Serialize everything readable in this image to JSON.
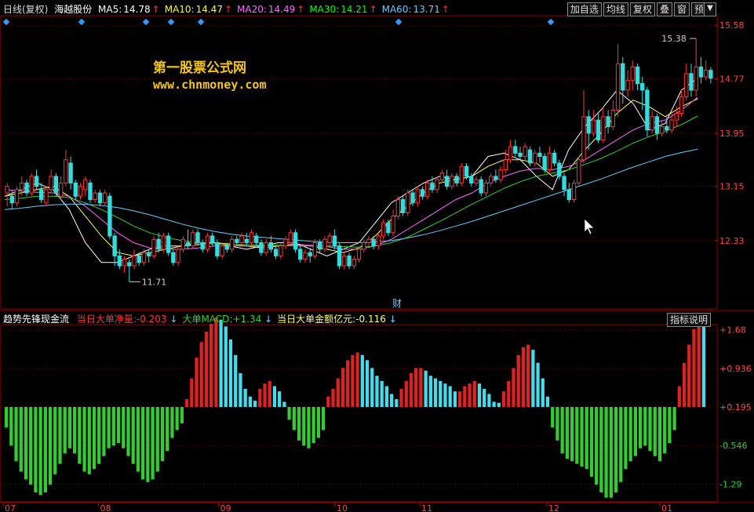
{
  "header": {
    "period": "日线(复权)",
    "stock_name": "海越股份",
    "ma": [
      {
        "label": "MA5:",
        "value": "14.78",
        "color": "#ffffff"
      },
      {
        "label": "MA10:",
        "value": "14.47",
        "color": "#ffff00"
      },
      {
        "label": "MA20:",
        "value": "14.49",
        "color": "#ff66ff"
      },
      {
        "label": "MA30:",
        "value": "14.21",
        "color": "#00ff00"
      },
      {
        "label": "MA60:",
        "value": "13.71",
        "color": "#66ccff"
      }
    ],
    "arrow": "↑"
  },
  "toolbar": {
    "buttons": [
      "加自选",
      "均线",
      "复权",
      "叠",
      "窗",
      "预测"
    ],
    "dropdown": "▼"
  },
  "watermark": {
    "line1": "第一股票公式网",
    "line2": "www.chnmoney.com"
  },
  "price_axis": [
    "15.58",
    "14.77",
    "13.95",
    "13.15",
    "12.33"
  ],
  "price_annotations": {
    "high": "15.38",
    "low": "11.71",
    "event": "财"
  },
  "indicator": {
    "title": "趋势先锋现金流",
    "items": [
      {
        "label": "当日大单净量:",
        "value": "-0.203",
        "arrow": "↓",
        "color": "#ff3333"
      },
      {
        "label": "大单MACD:",
        "value": "+1.34",
        "arrow": "↓",
        "color": "#33cc33"
      },
      {
        "label": "当日大单金额亿元:",
        "value": "-0.116",
        "arrow": "↓",
        "color": "#ffff66"
      }
    ],
    "help_button": "指标说明",
    "axis": [
      "+1.68",
      "+0.936",
      "+0.195",
      "-0.546",
      "-1.29"
    ]
  },
  "time_axis": [
    "07",
    "08",
    "09",
    "10",
    "11",
    "12",
    "01"
  ],
  "chart_data": {
    "type": "candlestick+bar",
    "price_range": [
      11.3,
      15.7
    ],
    "candles": [
      [
        13.05,
        13.15,
        12.85,
        13.2
      ],
      [
        13.0,
        12.9,
        12.8,
        13.1
      ],
      [
        12.9,
        13.1,
        12.85,
        13.15
      ],
      [
        13.1,
        13.2,
        13.0,
        13.3
      ],
      [
        13.2,
        13.05,
        13.0,
        13.25
      ],
      [
        13.05,
        13.3,
        13.0,
        13.35
      ],
      [
        13.3,
        13.15,
        13.1,
        13.4
      ],
      [
        13.1,
        12.95,
        12.9,
        13.2
      ],
      [
        12.9,
        13.1,
        12.85,
        13.15
      ],
      [
        13.1,
        13.3,
        13.05,
        13.4
      ],
      [
        13.3,
        13.05,
        13.0,
        13.35
      ],
      [
        13.0,
        13.2,
        12.95,
        13.3
      ],
      [
        13.2,
        13.55,
        13.15,
        13.7
      ],
      [
        13.5,
        13.2,
        13.1,
        13.6
      ],
      [
        13.2,
        13.0,
        12.95,
        13.25
      ],
      [
        13.0,
        13.15,
        12.95,
        13.2
      ],
      [
        13.1,
        13.25,
        13.0,
        13.3
      ],
      [
        13.2,
        12.95,
        12.9,
        13.25
      ],
      [
        12.95,
        13.05,
        12.9,
        13.1
      ],
      [
        13.05,
        12.9,
        12.85,
        13.1
      ],
      [
        12.9,
        13.05,
        12.85,
        13.1
      ],
      [
        13.0,
        12.4,
        12.35,
        13.05
      ],
      [
        12.4,
        12.1,
        11.95,
        12.45
      ],
      [
        12.1,
        11.95,
        11.9,
        12.2
      ],
      [
        11.95,
        12.05,
        11.85,
        12.1
      ],
      [
        12.0,
        11.95,
        11.71,
        12.05
      ],
      [
        11.95,
        12.1,
        11.9,
        12.2
      ],
      [
        12.1,
        12.0,
        11.95,
        12.15
      ],
      [
        12.0,
        12.15,
        11.95,
        12.2
      ],
      [
        12.15,
        12.1,
        12.0,
        12.2
      ],
      [
        12.1,
        12.35,
        12.05,
        12.4
      ],
      [
        12.35,
        12.2,
        12.15,
        12.45
      ],
      [
        12.2,
        12.4,
        12.15,
        12.45
      ],
      [
        12.4,
        12.15,
        12.1,
        12.45
      ],
      [
        12.15,
        12.0,
        11.95,
        12.2
      ],
      [
        12.0,
        12.2,
        11.95,
        12.25
      ],
      [
        12.2,
        12.35,
        12.15,
        12.4
      ],
      [
        12.3,
        12.25,
        12.2,
        12.5
      ],
      [
        12.25,
        12.45,
        12.2,
        12.5
      ],
      [
        12.45,
        12.3,
        12.25,
        12.5
      ],
      [
        12.3,
        12.2,
        12.15,
        12.35
      ],
      [
        12.2,
        12.4,
        12.15,
        12.45
      ],
      [
        12.4,
        12.3,
        12.25,
        12.45
      ],
      [
        12.3,
        12.1,
        12.05,
        12.35
      ],
      [
        12.1,
        12.25,
        12.05,
        12.3
      ],
      [
        12.25,
        12.2,
        12.15,
        12.3
      ],
      [
        12.2,
        12.35,
        12.15,
        12.4
      ],
      [
        12.35,
        12.3,
        12.25,
        12.4
      ],
      [
        12.3,
        12.4,
        12.25,
        12.45
      ],
      [
        12.35,
        12.3,
        12.25,
        12.45
      ],
      [
        12.3,
        12.45,
        12.25,
        12.5
      ],
      [
        12.4,
        12.3,
        12.25,
        12.45
      ],
      [
        12.3,
        12.15,
        12.1,
        12.35
      ],
      [
        12.15,
        12.3,
        12.1,
        12.35
      ],
      [
        12.3,
        12.2,
        12.15,
        12.4
      ],
      [
        12.2,
        12.1,
        12.05,
        12.25
      ],
      [
        12.1,
        12.25,
        12.05,
        12.3
      ],
      [
        12.25,
        12.35,
        12.2,
        12.4
      ],
      [
        12.3,
        12.45,
        12.25,
        12.5
      ],
      [
        12.45,
        12.2,
        12.15,
        12.5
      ],
      [
        12.2,
        12.05,
        12.0,
        12.25
      ],
      [
        12.05,
        12.15,
        12.0,
        12.2
      ],
      [
        12.15,
        12.1,
        12.0,
        12.2
      ],
      [
        12.1,
        12.3,
        12.05,
        12.35
      ],
      [
        12.3,
        12.2,
        12.15,
        12.35
      ],
      [
        12.2,
        12.35,
        12.15,
        12.4
      ],
      [
        12.3,
        12.4,
        12.25,
        12.45
      ],
      [
        12.4,
        12.25,
        12.2,
        12.5
      ],
      [
        12.25,
        11.95,
        11.9,
        12.3
      ],
      [
        11.95,
        12.1,
        11.9,
        12.15
      ],
      [
        12.1,
        11.95,
        11.9,
        12.15
      ],
      [
        11.95,
        12.05,
        11.9,
        12.1
      ],
      [
        12.05,
        12.2,
        12.0,
        12.25
      ],
      [
        12.2,
        12.3,
        12.15,
        12.35
      ],
      [
        12.3,
        12.35,
        12.25,
        12.4
      ],
      [
        12.35,
        12.25,
        12.2,
        12.4
      ],
      [
        12.25,
        12.4,
        12.2,
        12.45
      ],
      [
        12.4,
        12.6,
        12.35,
        12.65
      ],
      [
        12.6,
        12.45,
        12.4,
        12.65
      ],
      [
        12.45,
        12.7,
        12.4,
        12.8
      ],
      [
        12.7,
        12.95,
        12.65,
        13.0
      ],
      [
        12.95,
        12.75,
        12.7,
        13.0
      ],
      [
        12.75,
        13.05,
        12.7,
        13.1
      ],
      [
        13.05,
        12.9,
        12.85,
        13.1
      ],
      [
        12.9,
        13.1,
        12.85,
        13.15
      ],
      [
        13.1,
        13.0,
        12.95,
        13.15
      ],
      [
        13.0,
        13.2,
        12.95,
        13.25
      ],
      [
        13.2,
        13.1,
        13.05,
        13.3
      ],
      [
        13.1,
        13.25,
        13.05,
        13.3
      ],
      [
        13.25,
        13.35,
        13.2,
        13.4
      ],
      [
        13.3,
        13.15,
        13.1,
        13.4
      ],
      [
        13.15,
        13.3,
        13.1,
        13.35
      ],
      [
        13.3,
        13.2,
        13.15,
        13.35
      ],
      [
        13.2,
        13.45,
        13.15,
        13.5
      ],
      [
        13.45,
        13.3,
        13.25,
        13.5
      ],
      [
        13.3,
        13.2,
        13.15,
        13.35
      ],
      [
        13.2,
        13.25,
        13.15,
        13.3
      ],
      [
        13.25,
        13.05,
        13.0,
        13.3
      ],
      [
        13.05,
        13.2,
        13.0,
        13.25
      ],
      [
        13.2,
        13.3,
        13.15,
        13.35
      ],
      [
        13.3,
        13.25,
        13.2,
        13.4
      ],
      [
        13.25,
        13.4,
        13.2,
        13.45
      ],
      [
        13.4,
        13.55,
        13.35,
        13.7
      ],
      [
        13.55,
        13.75,
        13.5,
        13.85
      ],
      [
        13.75,
        13.65,
        13.6,
        13.85
      ],
      [
        13.65,
        13.6,
        13.55,
        13.75
      ],
      [
        13.6,
        13.75,
        13.55,
        13.8
      ],
      [
        13.7,
        13.5,
        13.45,
        13.75
      ],
      [
        13.5,
        13.65,
        13.45,
        13.7
      ],
      [
        13.65,
        13.6,
        13.5,
        13.75
      ],
      [
        13.6,
        13.4,
        13.35,
        13.65
      ],
      [
        13.4,
        13.65,
        13.35,
        13.75
      ],
      [
        13.65,
        13.5,
        13.45,
        13.7
      ],
      [
        13.5,
        13.3,
        13.25,
        13.55
      ],
      [
        13.3,
        13.1,
        13.0,
        13.35
      ],
      [
        13.1,
        12.95,
        12.9,
        13.2
      ],
      [
        12.95,
        13.2,
        12.9,
        13.25
      ],
      [
        13.2,
        13.55,
        13.15,
        13.6
      ],
      [
        13.55,
        14.2,
        13.5,
        14.6
      ],
      [
        14.2,
        13.95,
        13.7,
        14.3
      ],
      [
        13.95,
        14.15,
        13.9,
        14.3
      ],
      [
        14.15,
        13.85,
        13.8,
        14.25
      ],
      [
        13.85,
        14.2,
        13.8,
        14.35
      ],
      [
        14.2,
        14.05,
        13.95,
        14.3
      ],
      [
        14.05,
        14.3,
        14.0,
        14.45
      ],
      [
        14.3,
        15.0,
        14.2,
        15.3
      ],
      [
        15.0,
        14.6,
        14.4,
        15.1
      ],
      [
        14.6,
        14.75,
        14.5,
        14.9
      ],
      [
        14.75,
        14.95,
        14.6,
        15.05
      ],
      [
        14.95,
        14.7,
        14.6,
        15.0
      ],
      [
        14.7,
        14.6,
        14.3,
        14.8
      ],
      [
        14.6,
        14.0,
        13.9,
        14.65
      ],
      [
        14.0,
        14.2,
        13.95,
        14.3
      ],
      [
        14.2,
        13.95,
        13.85,
        14.25
      ],
      [
        13.95,
        14.05,
        13.9,
        14.15
      ],
      [
        14.05,
        14.0,
        13.95,
        14.2
      ],
      [
        14.0,
        14.15,
        13.95,
        14.25
      ],
      [
        14.15,
        14.25,
        14.05,
        14.35
      ],
      [
        14.25,
        14.5,
        14.2,
        14.6
      ],
      [
        14.5,
        14.85,
        14.45,
        15.0
      ],
      [
        14.85,
        14.6,
        14.5,
        15.0
      ],
      [
        14.6,
        14.95,
        14.5,
        15.38
      ],
      [
        14.95,
        14.8,
        14.7,
        15.1
      ],
      [
        14.8,
        14.9,
        14.75,
        15.05
      ],
      [
        14.9,
        14.78,
        14.7,
        14.95
      ]
    ],
    "ma_values": {
      "ma5": [
        13.0,
        13.1,
        13.2,
        13.1,
        12.8,
        12.3,
        12.0,
        12.0,
        12.1,
        12.2,
        12.25,
        12.25,
        12.3,
        12.3,
        12.25,
        12.2,
        12.25,
        12.3,
        12.3,
        12.2,
        12.1,
        12.2,
        12.3,
        12.6,
        12.9,
        13.05,
        13.2,
        13.3,
        13.25,
        13.3,
        13.6,
        13.65,
        13.55,
        13.3,
        13.1,
        13.7,
        14.05,
        14.3,
        14.6,
        14.4,
        14.0,
        14.1,
        14.6,
        14.78
      ],
      "ma10": [
        13.0,
        13.05,
        13.1,
        13.15,
        13.0,
        12.7,
        12.4,
        12.15,
        12.1,
        12.15,
        12.2,
        12.25,
        12.27,
        12.3,
        12.28,
        12.25,
        12.22,
        12.25,
        12.28,
        12.25,
        12.2,
        12.15,
        12.22,
        12.4,
        12.65,
        12.85,
        13.05,
        13.2,
        13.25,
        13.3,
        13.45,
        13.55,
        13.55,
        13.5,
        13.3,
        13.4,
        13.7,
        13.95,
        14.25,
        14.45,
        14.35,
        14.2,
        14.35,
        14.47
      ],
      "ma20": [
        13.1,
        13.08,
        13.06,
        13.05,
        13.0,
        12.85,
        12.65,
        12.45,
        12.3,
        12.22,
        12.2,
        12.2,
        12.22,
        12.25,
        12.25,
        12.25,
        12.25,
        12.25,
        12.26,
        12.26,
        12.24,
        12.2,
        12.2,
        12.25,
        12.35,
        12.5,
        12.65,
        12.8,
        12.95,
        13.05,
        13.2,
        13.3,
        13.38,
        13.42,
        13.4,
        13.45,
        13.55,
        13.7,
        13.85,
        14.0,
        14.1,
        14.15,
        14.3,
        14.49
      ],
      "ma30": [
        12.95,
        12.97,
        13.0,
        13.0,
        12.98,
        12.9,
        12.8,
        12.68,
        12.55,
        12.45,
        12.38,
        12.33,
        12.3,
        12.28,
        12.27,
        12.27,
        12.26,
        12.26,
        12.25,
        12.25,
        12.25,
        12.24,
        12.23,
        12.25,
        12.3,
        12.38,
        12.5,
        12.62,
        12.75,
        12.88,
        13.0,
        13.12,
        13.22,
        13.3,
        13.35,
        13.4,
        13.48,
        13.57,
        13.68,
        13.8,
        13.9,
        13.98,
        14.08,
        14.21
      ],
      "ma60": [
        12.8,
        12.82,
        12.85,
        12.87,
        12.88,
        12.88,
        12.86,
        12.83,
        12.78,
        12.72,
        12.65,
        12.58,
        12.52,
        12.47,
        12.43,
        12.4,
        12.38,
        12.36,
        12.34,
        12.32,
        12.31,
        12.3,
        12.3,
        12.31,
        12.33,
        12.37,
        12.42,
        12.48,
        12.55,
        12.62,
        12.7,
        12.78,
        12.86,
        12.94,
        13.02,
        13.1,
        13.18,
        13.26,
        13.35,
        13.44,
        13.52,
        13.6,
        13.66,
        13.71
      ]
    },
    "indicator_range": [
      -1.6,
      1.75
    ],
    "indicator_bars": [
      -0.2,
      -0.55,
      -0.85,
      -1.05,
      -1.2,
      -1.3,
      -1.45,
      -1.5,
      -1.45,
      -1.3,
      -1.1,
      -0.9,
      -0.7,
      -0.6,
      -0.7,
      -0.9,
      -1.05,
      -1.1,
      -1.0,
      -0.9,
      -0.75,
      -0.6,
      -0.55,
      -0.5,
      -0.6,
      -0.75,
      -0.9,
      -1.05,
      -1.2,
      -1.25,
      -1.2,
      -1.05,
      -0.85,
      -0.65,
      -0.4,
      -0.25,
      -0.12,
      0.15,
      0.55,
      0.95,
      1.25,
      1.45,
      1.6,
      1.72,
      1.68,
      1.55,
      1.3,
      1.0,
      0.65,
      0.35,
      0.2,
      0.12,
      0.35,
      0.45,
      0.5,
      0.4,
      0.3,
      0.1,
      -0.05,
      -0.25,
      -0.45,
      -0.55,
      -0.6,
      -0.5,
      -0.4,
      -0.25,
      0.2,
      0.35,
      0.55,
      0.75,
      0.9,
      1.0,
      1.05,
      1.0,
      0.9,
      0.75,
      0.6,
      0.5,
      0.4,
      0.25,
      0.15,
      0.35,
      0.5,
      0.65,
      0.75,
      0.75,
      0.7,
      0.6,
      0.55,
      0.5,
      0.45,
      0.4,
      0.3,
      0.3,
      0.4,
      0.45,
      0.5,
      0.45,
      0.35,
      0.25,
      0.1,
      0.08,
      0.3,
      0.5,
      0.75,
      1.0,
      1.15,
      1.2,
      1.1,
      0.85,
      0.55,
      0.2,
      -0.2,
      -0.45,
      -0.7,
      -0.8,
      -0.85,
      -0.9,
      -0.95,
      -1.0,
      -1.15,
      -1.3,
      -1.45,
      -1.55,
      -1.55,
      -1.45,
      -1.25,
      -1.0,
      -0.85,
      -0.75,
      -0.6,
      -0.55,
      -0.65,
      -0.75,
      -0.85,
      -0.7,
      -0.5,
      -0.25,
      0.4,
      0.85,
      1.2,
      1.5,
      1.7,
      1.55
    ]
  }
}
